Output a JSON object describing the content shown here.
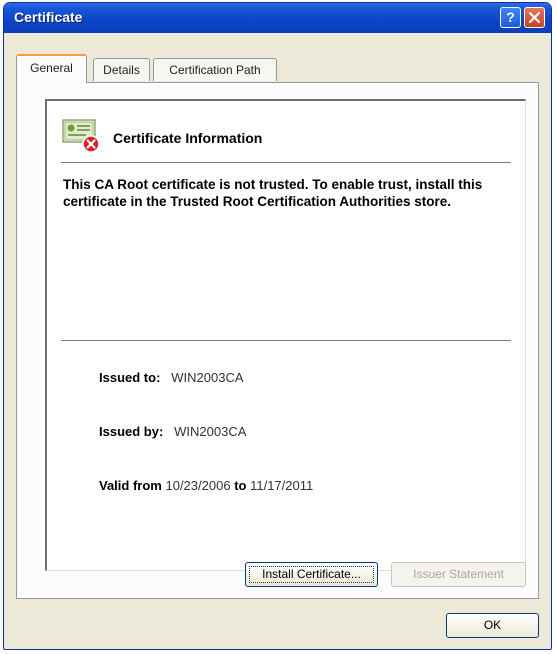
{
  "window": {
    "title": "Certificate",
    "help_label": "?"
  },
  "tabs": [
    {
      "label": "General",
      "active": true
    },
    {
      "label": "Details",
      "active": false
    },
    {
      "label": "Certification Path",
      "active": false
    }
  ],
  "info": {
    "title": "Certificate Information",
    "message": "This CA Root certificate is not trusted. To enable trust, install this certificate in the Trusted Root Certification Authorities store.",
    "issued_to_label": "Issued to:",
    "issued_to": "WIN2003CA",
    "issued_by_label": "Issued by:",
    "issued_by": "WIN2003CA",
    "valid_from_label": "Valid from",
    "valid_from": "10/23/2006",
    "valid_to_label": "to",
    "valid_to": "11/17/2011"
  },
  "buttons": {
    "install": "Install Certificate...",
    "issuer_statement": "Issuer Statement",
    "ok": "OK"
  },
  "icons": {
    "certificate": "certificate-error-icon",
    "help": "help-icon",
    "close": "close-icon"
  },
  "colors": {
    "titlebar": "#0a45c8",
    "close_button": "#c8401f",
    "active_tab_highlight": "#f2a03d",
    "error_badge": "#e02020"
  }
}
